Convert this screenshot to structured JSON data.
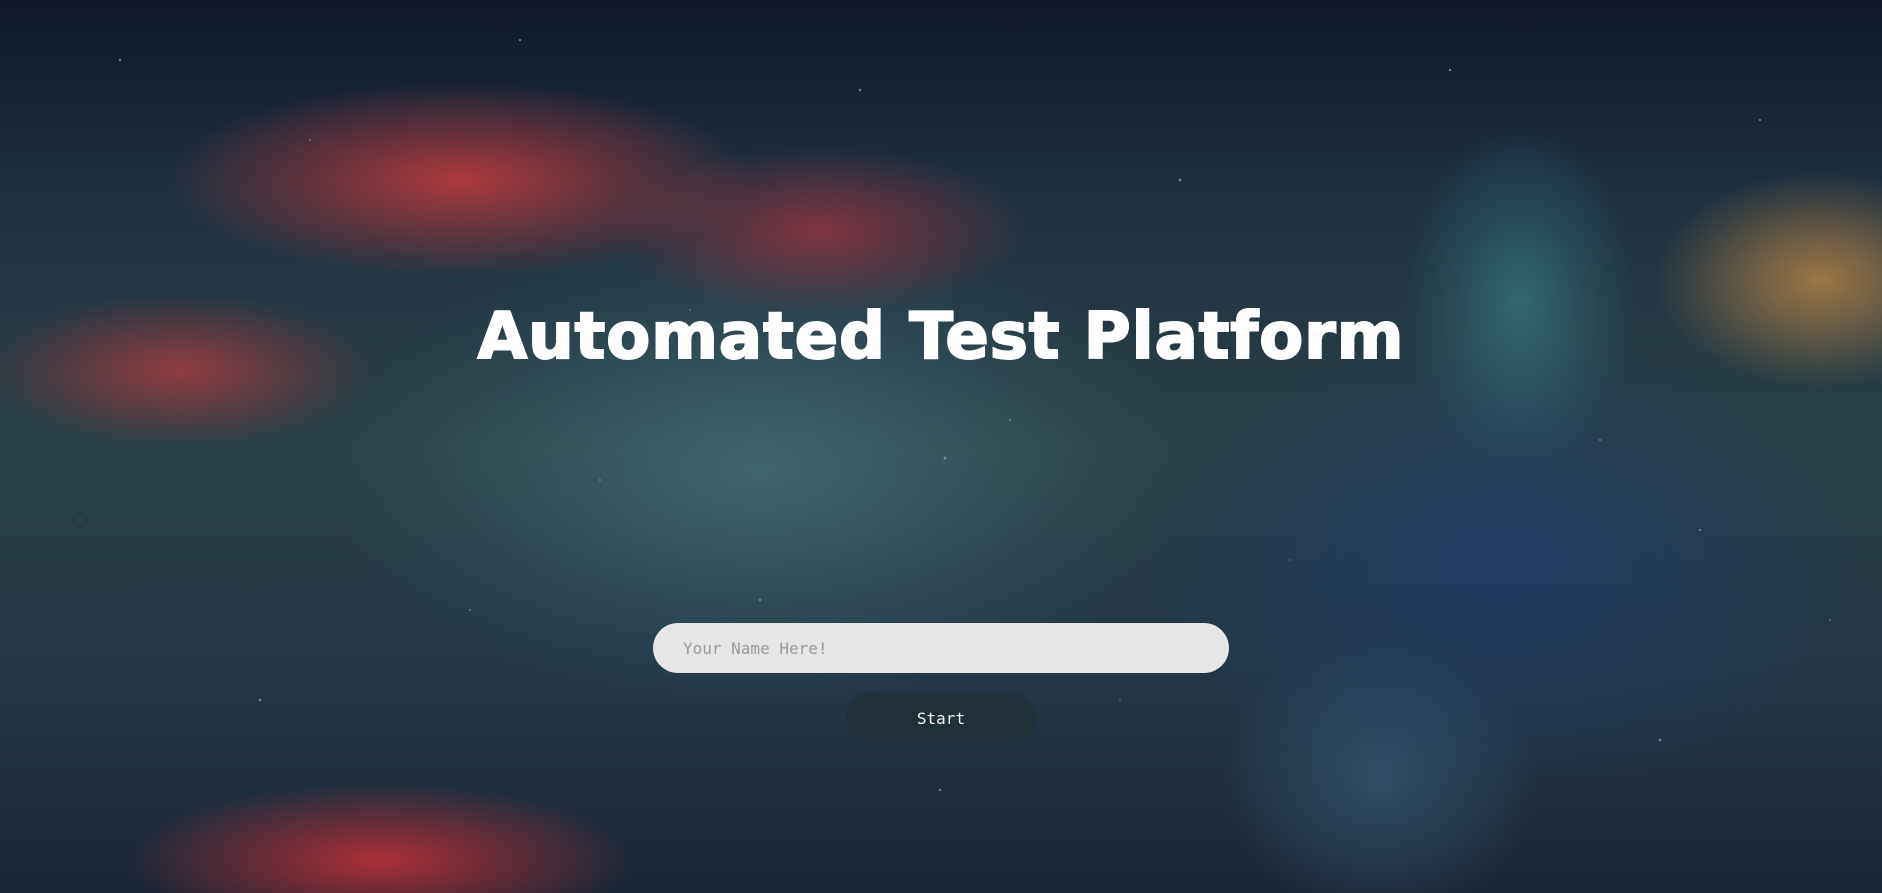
{
  "page": {
    "title": "Automated Test Platform"
  },
  "form": {
    "name_placeholder": "Your Name Here!",
    "name_value": "",
    "start_label": "Start"
  },
  "colors": {
    "title": "#ffffff",
    "input_background": "#e6e6e6",
    "button_background": "#203038",
    "button_text": "#f2f2f2"
  }
}
